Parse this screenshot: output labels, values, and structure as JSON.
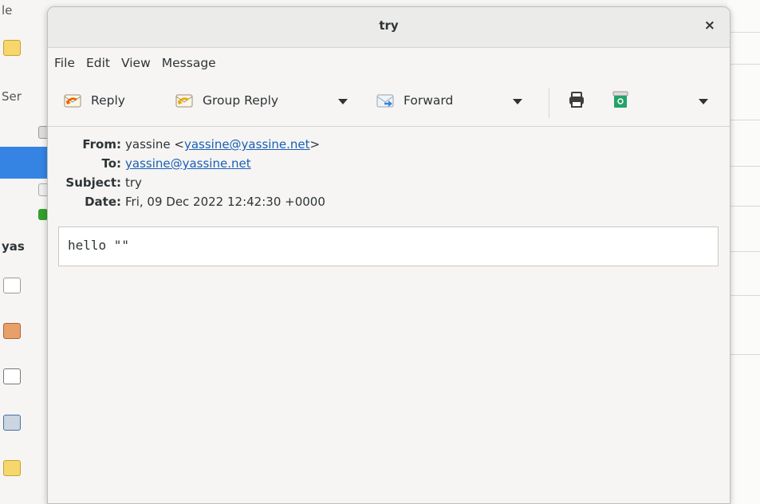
{
  "background": {
    "left_labels": [
      "le",
      "Ser",
      "yas"
    ]
  },
  "window": {
    "title": "try",
    "close_glyph": "×"
  },
  "menubar": {
    "items": [
      "File",
      "Edit",
      "View",
      "Message"
    ]
  },
  "toolbar": {
    "reply_label": "Reply",
    "group_reply_label": "Group Reply",
    "forward_label": "Forward",
    "icons": [
      "reply-icon",
      "group-reply-icon",
      "forward-icon",
      "print-icon",
      "trash-icon"
    ]
  },
  "headers": {
    "from_label": "From:",
    "from_name": "yassine <",
    "from_email": "yassine@yassine.net",
    "from_suffix": ">",
    "to_label": "To:",
    "to_email": "yassine@yassine.net",
    "subject_label": "Subject:",
    "subject_value": "try",
    "date_label": "Date:",
    "date_value": "Fri, 09 Dec 2022 12:42:30 +0000"
  },
  "message": {
    "body": "hello \"\""
  },
  "colors": {
    "link": "#1a5fb4",
    "selection": "#3584e4",
    "reply_arrow": "#e66100",
    "trash": "#26a269"
  }
}
